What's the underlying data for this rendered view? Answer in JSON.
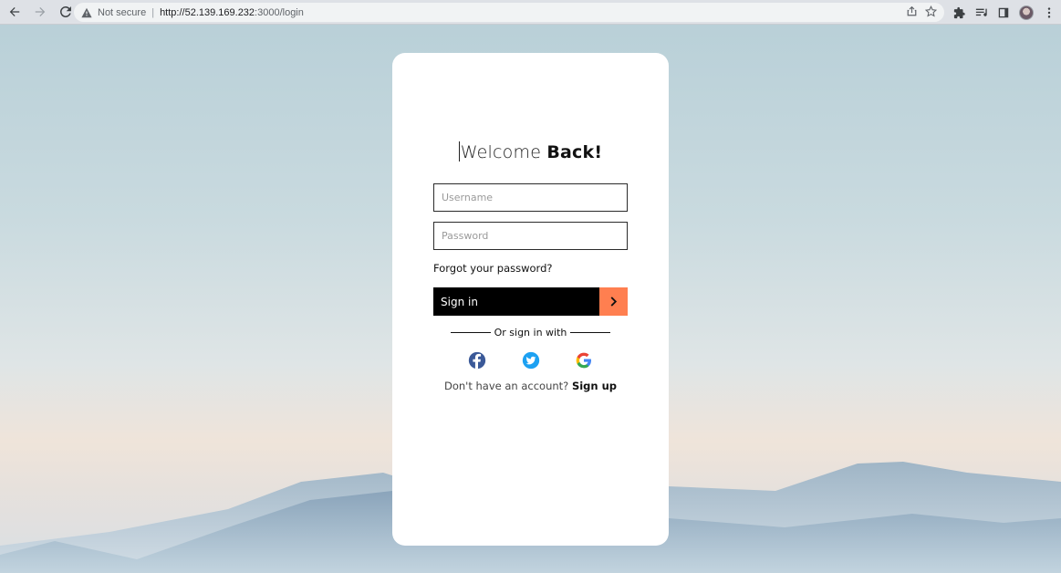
{
  "browser": {
    "security_label": "Not secure",
    "url_host": "http://52.139.169.232",
    "url_path": ":3000/login"
  },
  "login": {
    "heading_light": "Welcome ",
    "heading_bold": "Back!",
    "username_placeholder": "Username",
    "password_placeholder": "Password",
    "forgot_label": "Forgot your password?",
    "signin_label": "Sign in",
    "divider_label": "Or sign in with",
    "no_account_text": "Don't have an account?",
    "signup_label": "Sign up"
  },
  "socials": [
    {
      "name": "facebook",
      "color": "#3b5998"
    },
    {
      "name": "twitter",
      "color": "#1da1f2"
    },
    {
      "name": "google",
      "color": "#4285f4"
    }
  ],
  "colors": {
    "accent": "#ff7f50",
    "button": "#000000",
    "card": "#ffffff"
  }
}
